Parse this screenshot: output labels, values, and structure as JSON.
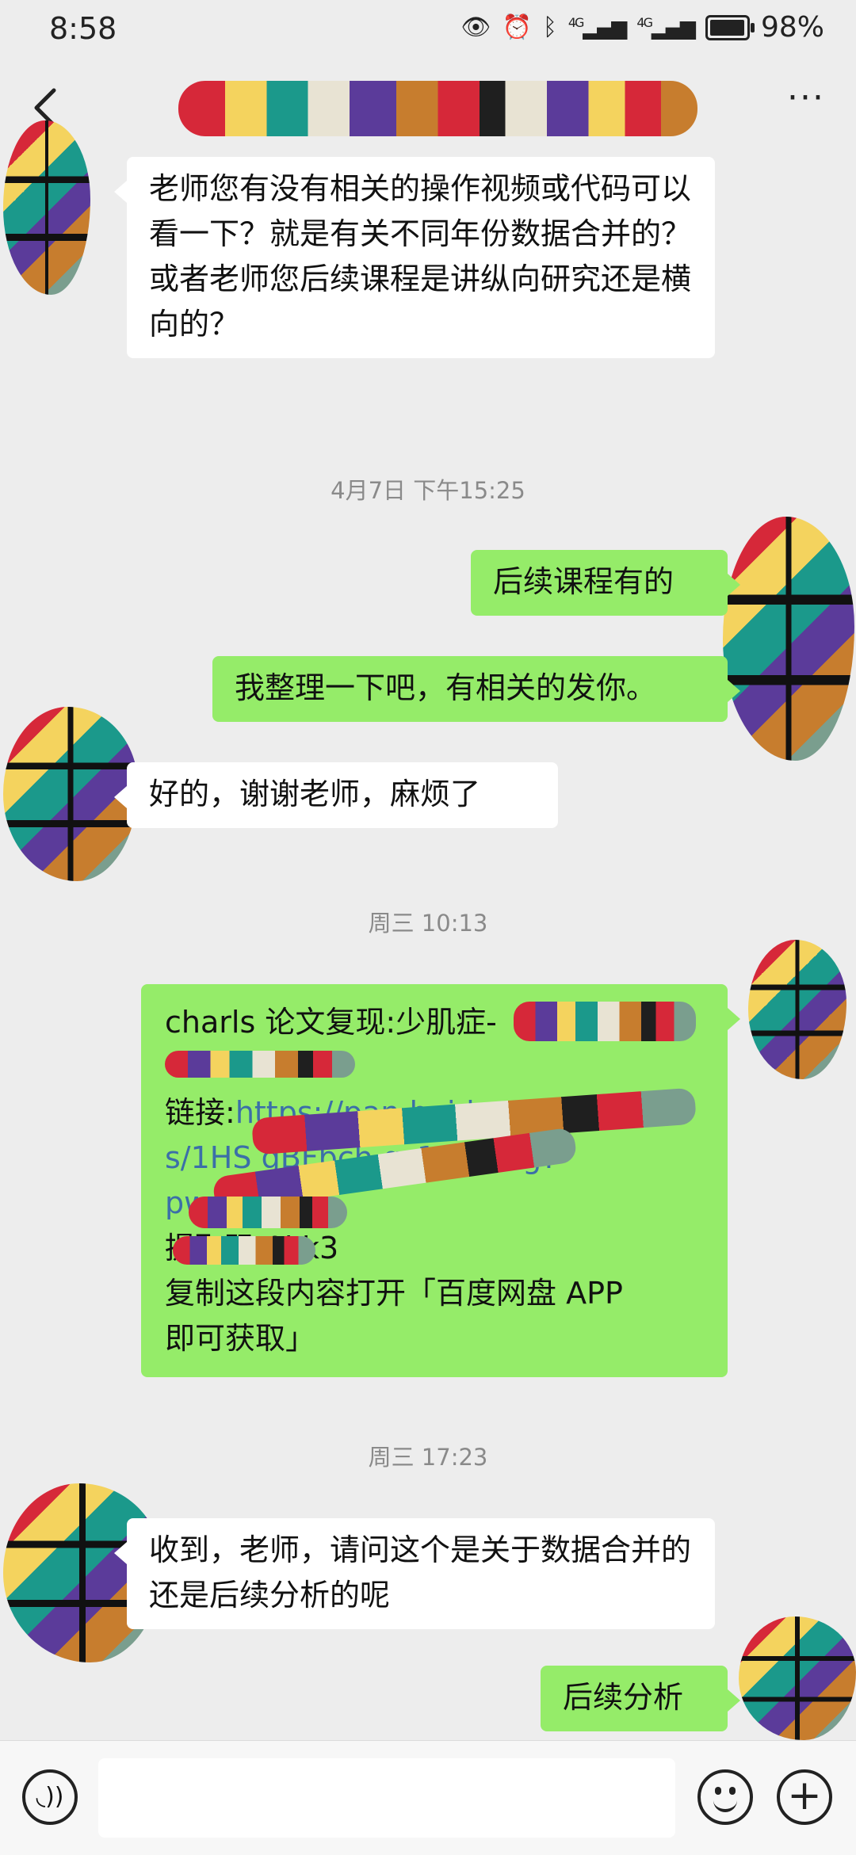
{
  "status_bar": {
    "time": "8:58",
    "signal_1": "4G",
    "signal_2": "4G",
    "battery_percent": "98%",
    "battery_level": 0.98
  },
  "header": {
    "back_icon": "chevron-left-icon",
    "more_icon": "more-horizontal-icon",
    "more_label": "···"
  },
  "messages": [
    {
      "side": "received",
      "text": "老师您有没有相关的操作视频或代码可以看一下？就是有关不同年份数据合并的？\n或者老师您后续课程是讲纵向研究还是横向的？"
    },
    {
      "type": "timestamp",
      "text": "4月7日 下午15:25"
    },
    {
      "side": "sent",
      "text": "后续课程有的"
    },
    {
      "side": "sent",
      "text": "我整理一下吧，有相关的发你。"
    },
    {
      "side": "received",
      "text": "好的，谢谢老师，麻烦了"
    },
    {
      "type": "timestamp",
      "text": "周三 10:13"
    },
    {
      "side": "sent",
      "line1": "charls 论文复现:少肌症-",
      "line3_prefix": "链接:",
      "line3_link": "https://pan.baidu.com/",
      "line4": "s/1HS",
      "line4_b": "gBFbch",
      "line4_c": "q_1GnGAg?",
      "line5": "pwd=",
      "line6": "提取码:0kk3",
      "line7": "复制这段内容打开「百度网盘 APP",
      "line8": "即可获取」"
    },
    {
      "type": "timestamp",
      "text": "周三 17:23"
    },
    {
      "side": "received",
      "text": "收到，老师，请问这个是关于数据合并的还是后续分析的呢"
    },
    {
      "side": "sent",
      "text": "后续分析"
    }
  ],
  "input_bar": {
    "voice_icon": "voice-icon",
    "emoji_icon": "emoji-icon",
    "plus_icon": "plus-icon",
    "plus_label": "+",
    "voice_label": "◟))",
    "text_value": ""
  },
  "colors": {
    "background": "#ededed",
    "sent_bubble": "#95ec69",
    "received_bubble": "#ffffff",
    "timestamp_text": "#8a8a8a"
  }
}
